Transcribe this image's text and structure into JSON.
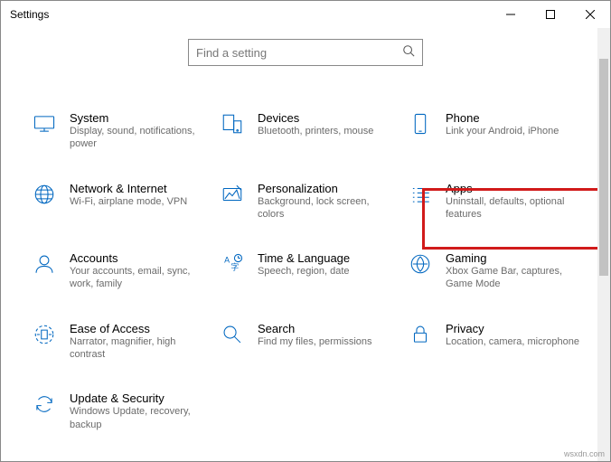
{
  "window": {
    "title": "Settings"
  },
  "search": {
    "placeholder": "Find a setting"
  },
  "tiles": {
    "system": {
      "title": "System",
      "desc": "Display, sound, notifications, power"
    },
    "devices": {
      "title": "Devices",
      "desc": "Bluetooth, printers, mouse"
    },
    "phone": {
      "title": "Phone",
      "desc": "Link your Android, iPhone"
    },
    "network": {
      "title": "Network & Internet",
      "desc": "Wi-Fi, airplane mode, VPN"
    },
    "personalization": {
      "title": "Personalization",
      "desc": "Background, lock screen, colors"
    },
    "apps": {
      "title": "Apps",
      "desc": "Uninstall, defaults, optional features"
    },
    "accounts": {
      "title": "Accounts",
      "desc": "Your accounts, email, sync, work, family"
    },
    "time": {
      "title": "Time & Language",
      "desc": "Speech, region, date"
    },
    "gaming": {
      "title": "Gaming",
      "desc": "Xbox Game Bar, captures, Game Mode"
    },
    "ease": {
      "title": "Ease of Access",
      "desc": "Narrator, magnifier, high contrast"
    },
    "search_tile": {
      "title": "Search",
      "desc": "Find my files, permissions"
    },
    "privacy": {
      "title": "Privacy",
      "desc": "Location, camera, microphone"
    },
    "update": {
      "title": "Update & Security",
      "desc": "Windows Update, recovery, backup"
    }
  },
  "watermark": "wsxdn.com"
}
